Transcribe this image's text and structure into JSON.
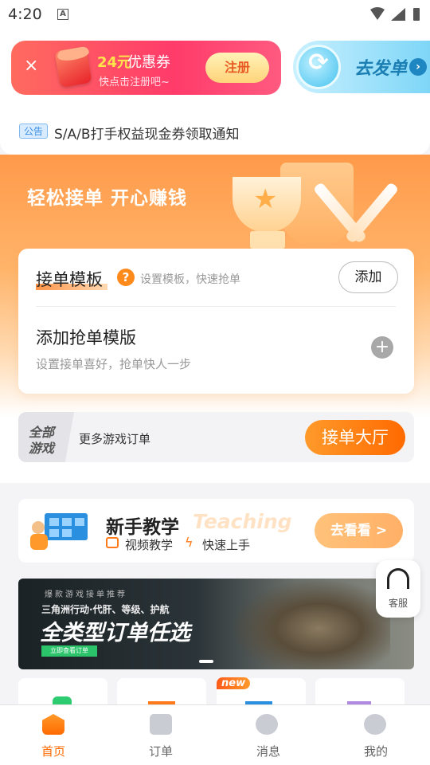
{
  "status_bar": {
    "time": "4:20",
    "notif_icon": "A"
  },
  "coupon": {
    "close": "×",
    "amount": "24元",
    "title": "优惠券",
    "subtitle": "快点击注册吧~",
    "register": "注册"
  },
  "dispatch": {
    "label": "去发单",
    "chevron": "›"
  },
  "notice": {
    "badge": "公告",
    "text": "S/A/B打手权益现金券领取通知"
  },
  "hero": {
    "slogan": "轻松接单 开心赚钱"
  },
  "template": {
    "title": "接单模板",
    "help": "?",
    "hint": "设置模板，快速抢单",
    "add": "添加",
    "add_title": "添加抢单模版",
    "add_sub": "设置接单喜好，抢单快人一步",
    "plus": "+"
  },
  "games": {
    "badge_line1": "全部",
    "badge_line2": "游戏",
    "text": "更多游戏订单",
    "hall_button": "接单大厅"
  },
  "tutorial": {
    "title": "新手教学",
    "ghost": "Teaching",
    "video": "视频教学",
    "quick": "快速上手",
    "watch": "去看看 >"
  },
  "ad": {
    "kicker": "爆款游戏接单推荐",
    "line2": "三角洲行动·代肝、等级、护航",
    "headline": "全类型订单任选",
    "cta": "立即查看订单"
  },
  "service": {
    "label": "客服"
  },
  "mini_cards": {
    "new_tag": "new"
  },
  "tabbar": {
    "tabs": [
      {
        "label": "首页",
        "active": true
      },
      {
        "label": "订单"
      },
      {
        "label": "消息"
      },
      {
        "label": "我的"
      }
    ],
    "active_color": "#ff6a00"
  }
}
